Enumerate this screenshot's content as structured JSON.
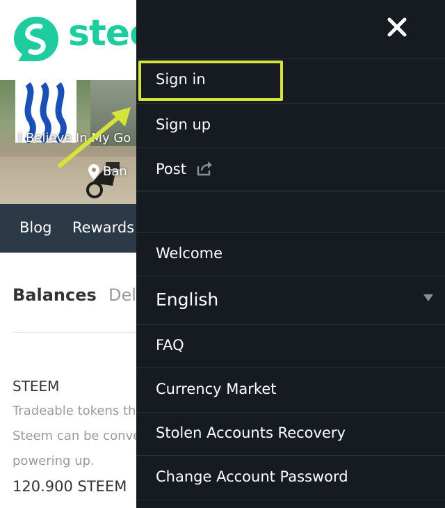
{
  "logo": {
    "text": "stee"
  },
  "cover": {
    "tagline": "I Believe In My Go",
    "location": "Ban"
  },
  "profile_nav": {
    "items": [
      {
        "label": "Blog"
      },
      {
        "label": "Rewards"
      }
    ]
  },
  "wallet": {
    "tabs": [
      {
        "label": "Balances"
      },
      {
        "label": "Del"
      }
    ],
    "steem": {
      "title": "STEEM",
      "desc_lines": [
        "Tradeable tokens th",
        "Steem can be conve",
        "powering up."
      ],
      "balance": "120.900 STEEM"
    }
  },
  "drawer": {
    "items": {
      "signin": "Sign in",
      "signup": "Sign up",
      "post": "Post",
      "welcome": "Welcome",
      "language": "English",
      "faq": "FAQ",
      "market": "Currency Market",
      "stolen": "Stolen Accounts Recovery",
      "change_password": "Change Account Password"
    }
  },
  "colors": {
    "brand": "#1fcca0",
    "drawer_bg": "#161b22",
    "highlight": "#d6e33a",
    "profile_nav_bg": "#2c3a47"
  },
  "icons": [
    "steemit-logo-icon",
    "close-icon",
    "share-icon",
    "location-pin-icon",
    "caret-down-icon"
  ]
}
